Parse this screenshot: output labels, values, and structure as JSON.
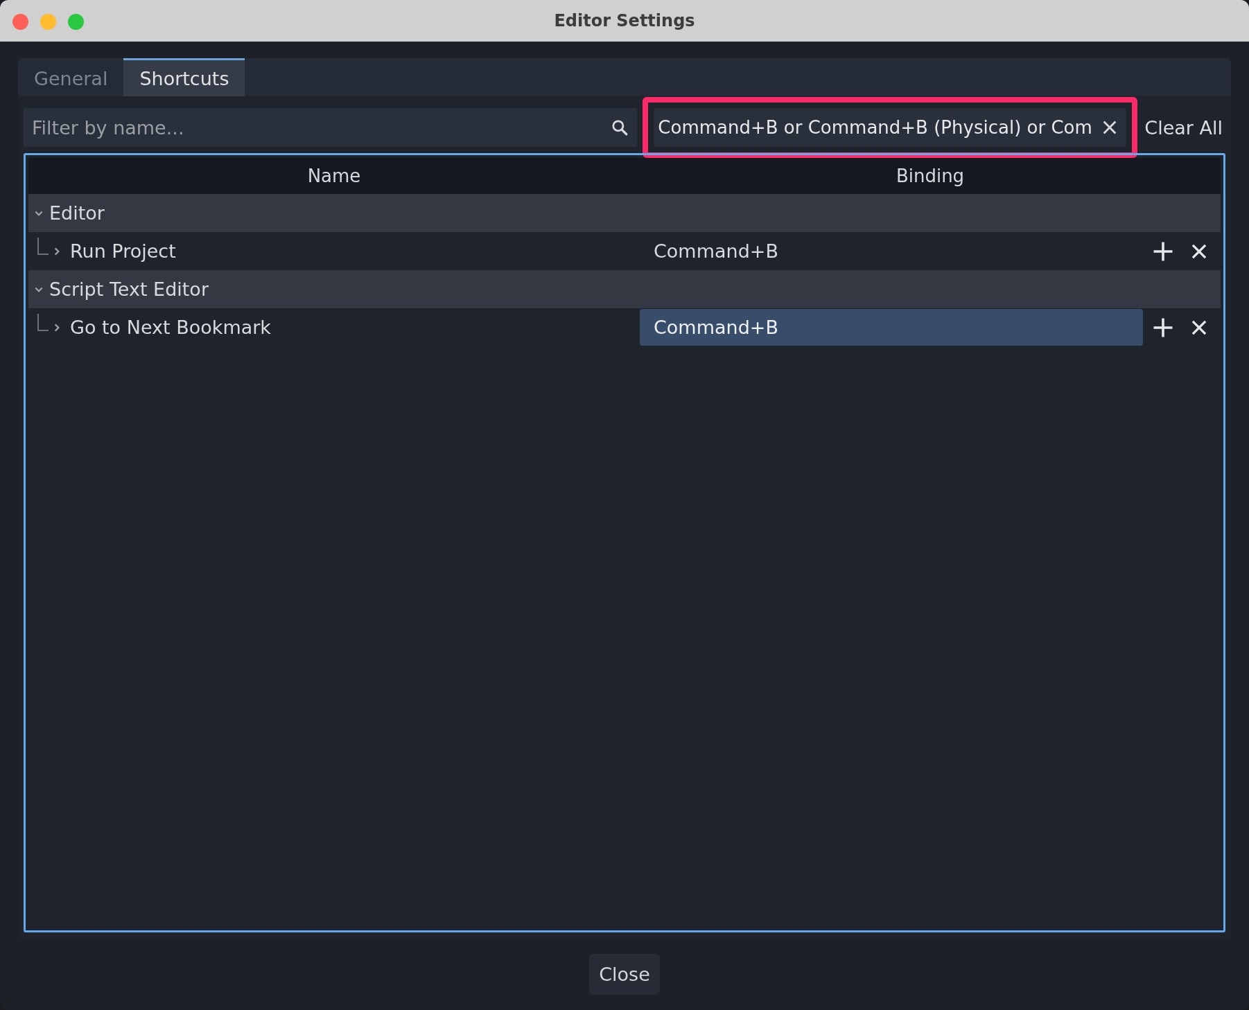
{
  "window": {
    "title": "Editor Settings"
  },
  "tabs": [
    {
      "label": "General",
      "selected": false
    },
    {
      "label": "Shortcuts",
      "selected": true
    }
  ],
  "filter": {
    "placeholder": "Filter by name..."
  },
  "binding_filter": {
    "value": "Command+B or Command+B (Physical) or Com",
    "highlighted": true
  },
  "clear_all": "Clear All",
  "table": {
    "columns": [
      "Name",
      "Binding"
    ],
    "groups": [
      {
        "label": "Editor",
        "expanded": true,
        "children": [
          {
            "label": "Run Project",
            "expanded": false,
            "binding": "Command+B",
            "selected": false
          }
        ]
      },
      {
        "label": "Script Text Editor",
        "expanded": true,
        "children": [
          {
            "label": "Go to Next Bookmark",
            "expanded": false,
            "binding": "Command+B",
            "selected": true
          }
        ]
      }
    ]
  },
  "buttons": [
    "Close"
  ]
}
